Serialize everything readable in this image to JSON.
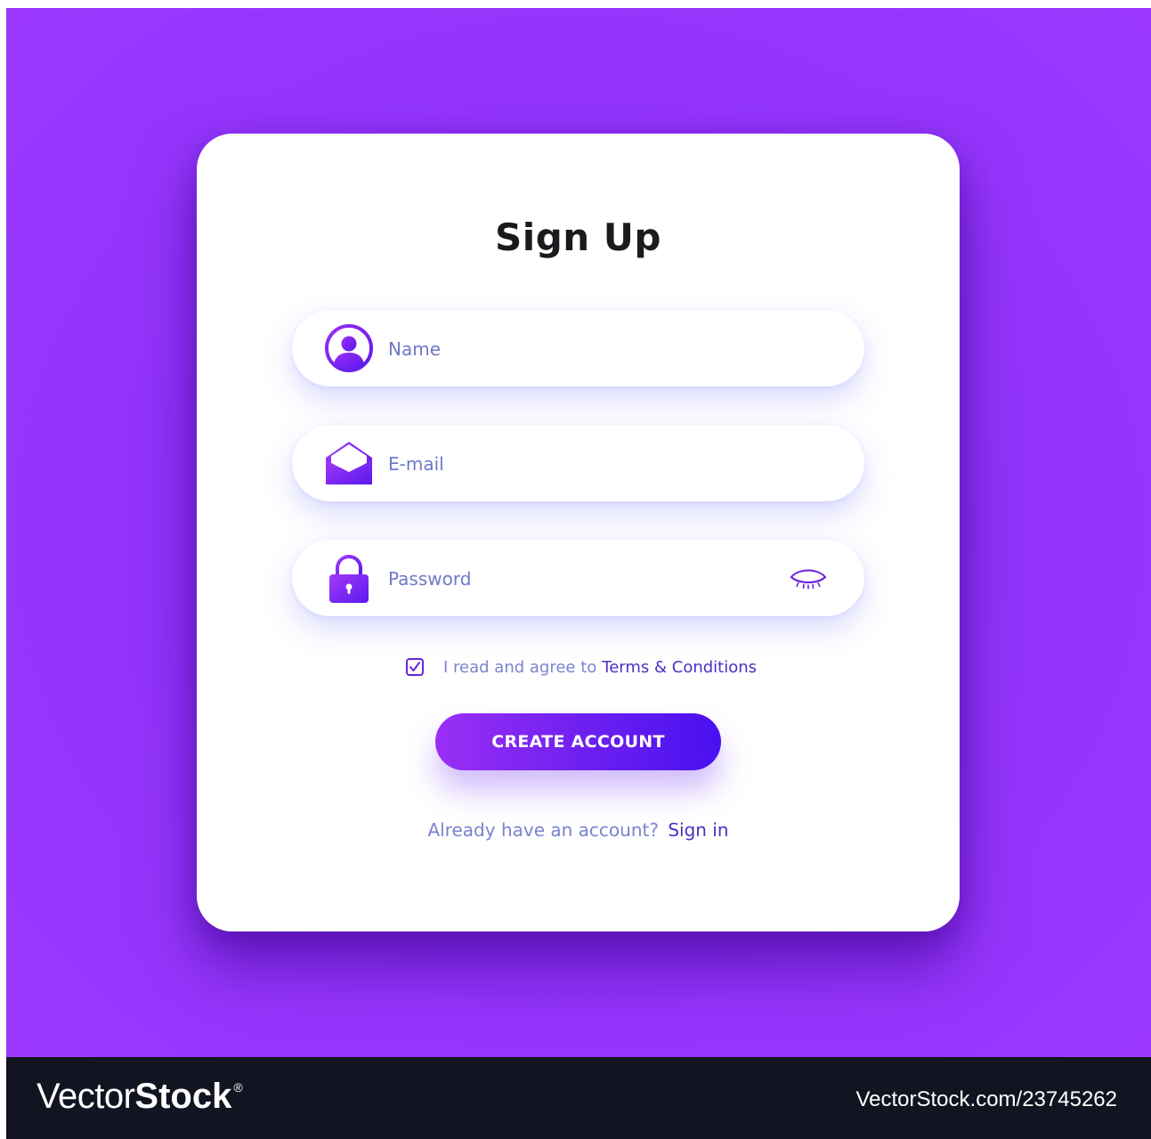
{
  "signup": {
    "title": "Sign Up",
    "name_placeholder": "Name",
    "email_placeholder": "E-mail",
    "password_placeholder": "Password",
    "agree_text": "I read and agree to",
    "terms_link": "Terms & Conditions",
    "terms_checked": true,
    "create_button": "CREATE ACCOUNT",
    "signin_prompt": "Already have an account?",
    "signin_link": "Sign in"
  },
  "icons": {
    "name_field": "user-avatar-icon",
    "email_field": "envelope-icon",
    "password_field": "padlock-icon",
    "password_toggle": "eye-closed-icon",
    "checkbox": "checkmark-icon"
  },
  "colors": {
    "background": "#9234fb",
    "card": "#ffffff",
    "accent": "#6a22e0",
    "button_gradient_start": "#9a2ff5",
    "button_gradient_end": "#4a10f0",
    "link": "#4b2fc6",
    "muted_text": "#7a83cf",
    "footer": "#121521"
  },
  "footer": {
    "logo_light": "Vector",
    "logo_bold": "Stock",
    "logo_mark": "®",
    "url": "VectorStock.com/23745262"
  }
}
